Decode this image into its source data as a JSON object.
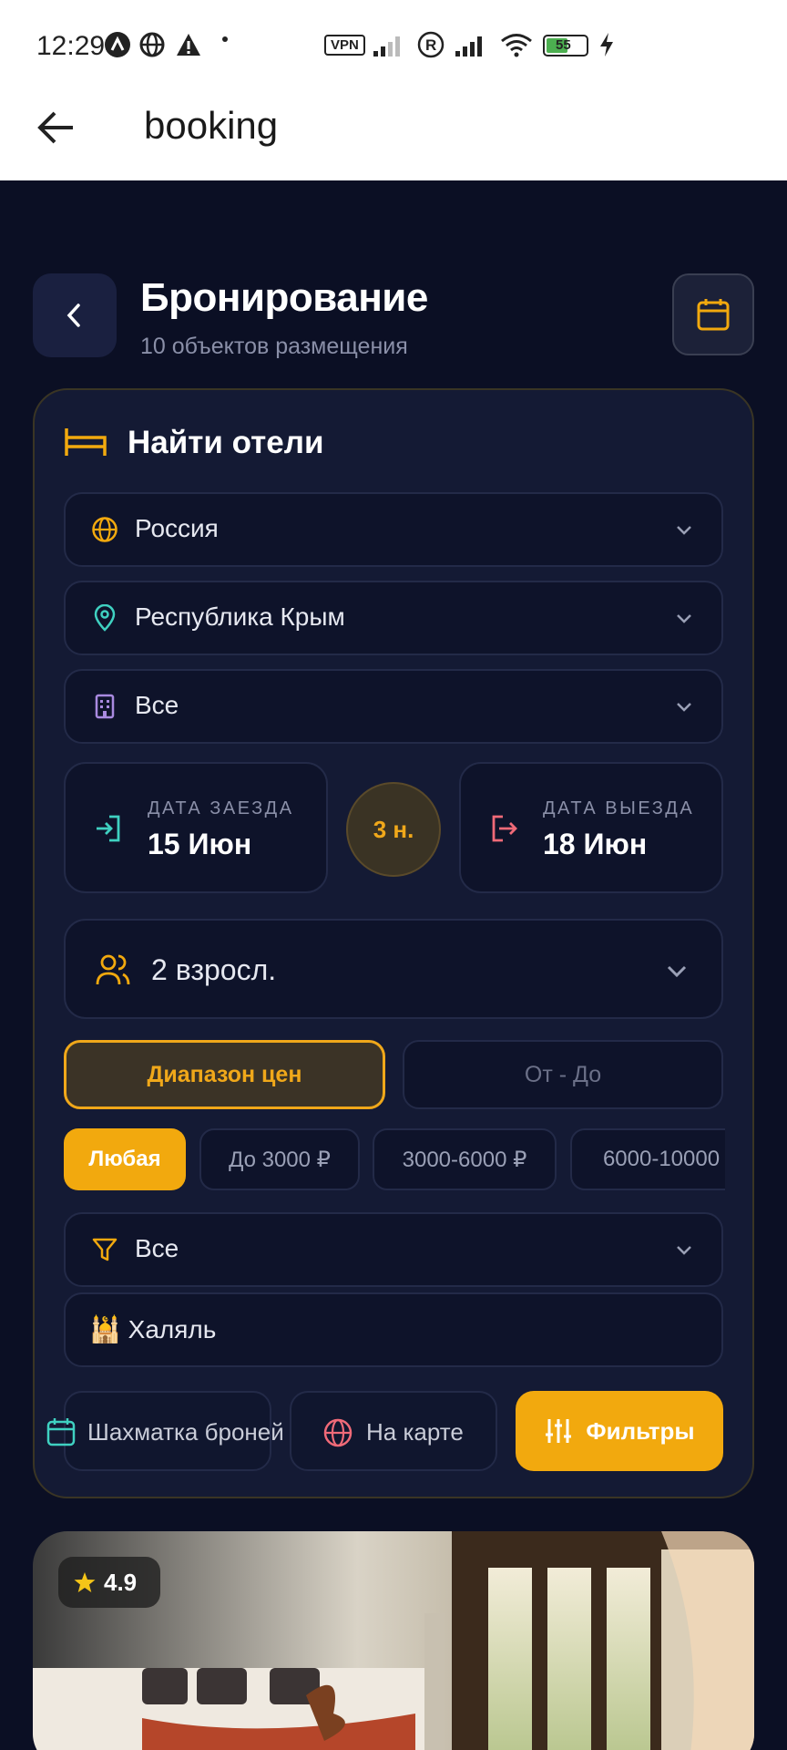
{
  "status_bar": {
    "time": "12:29",
    "vpn": "VPN",
    "battery": "55"
  },
  "app_bar": {
    "title": "booking"
  },
  "header": {
    "title": "Бронирование",
    "subtitle": "10 объектов размещения"
  },
  "search": {
    "title": "Найти отели",
    "country": "Россия",
    "region": "Республика Крым",
    "property_type": "Все",
    "checkin": {
      "label": "ДАТА ЗАЕЗДА",
      "value": "15 Июн"
    },
    "checkout": {
      "label": "ДАТА ВЫЕЗДА",
      "value": "18 Июн"
    },
    "nights": "3 н.",
    "guests": "2 взросл.",
    "price_mode": {
      "active": "Диапазон цен",
      "inactive": "От - До"
    },
    "price_chips": [
      "Любая",
      "До 3000 ₽",
      "3000-6000 ₽",
      "6000-10000"
    ],
    "category": "Все",
    "halal": "🕌 Халяль",
    "buttons": {
      "chess": "Шахматка броней",
      "map": "На карте",
      "filters": "Фильтры"
    }
  },
  "hotel_card": {
    "rating": "4.9"
  },
  "colors": {
    "accent": "#f2a90e",
    "background": "#0b0f24",
    "card": "#141a34"
  }
}
